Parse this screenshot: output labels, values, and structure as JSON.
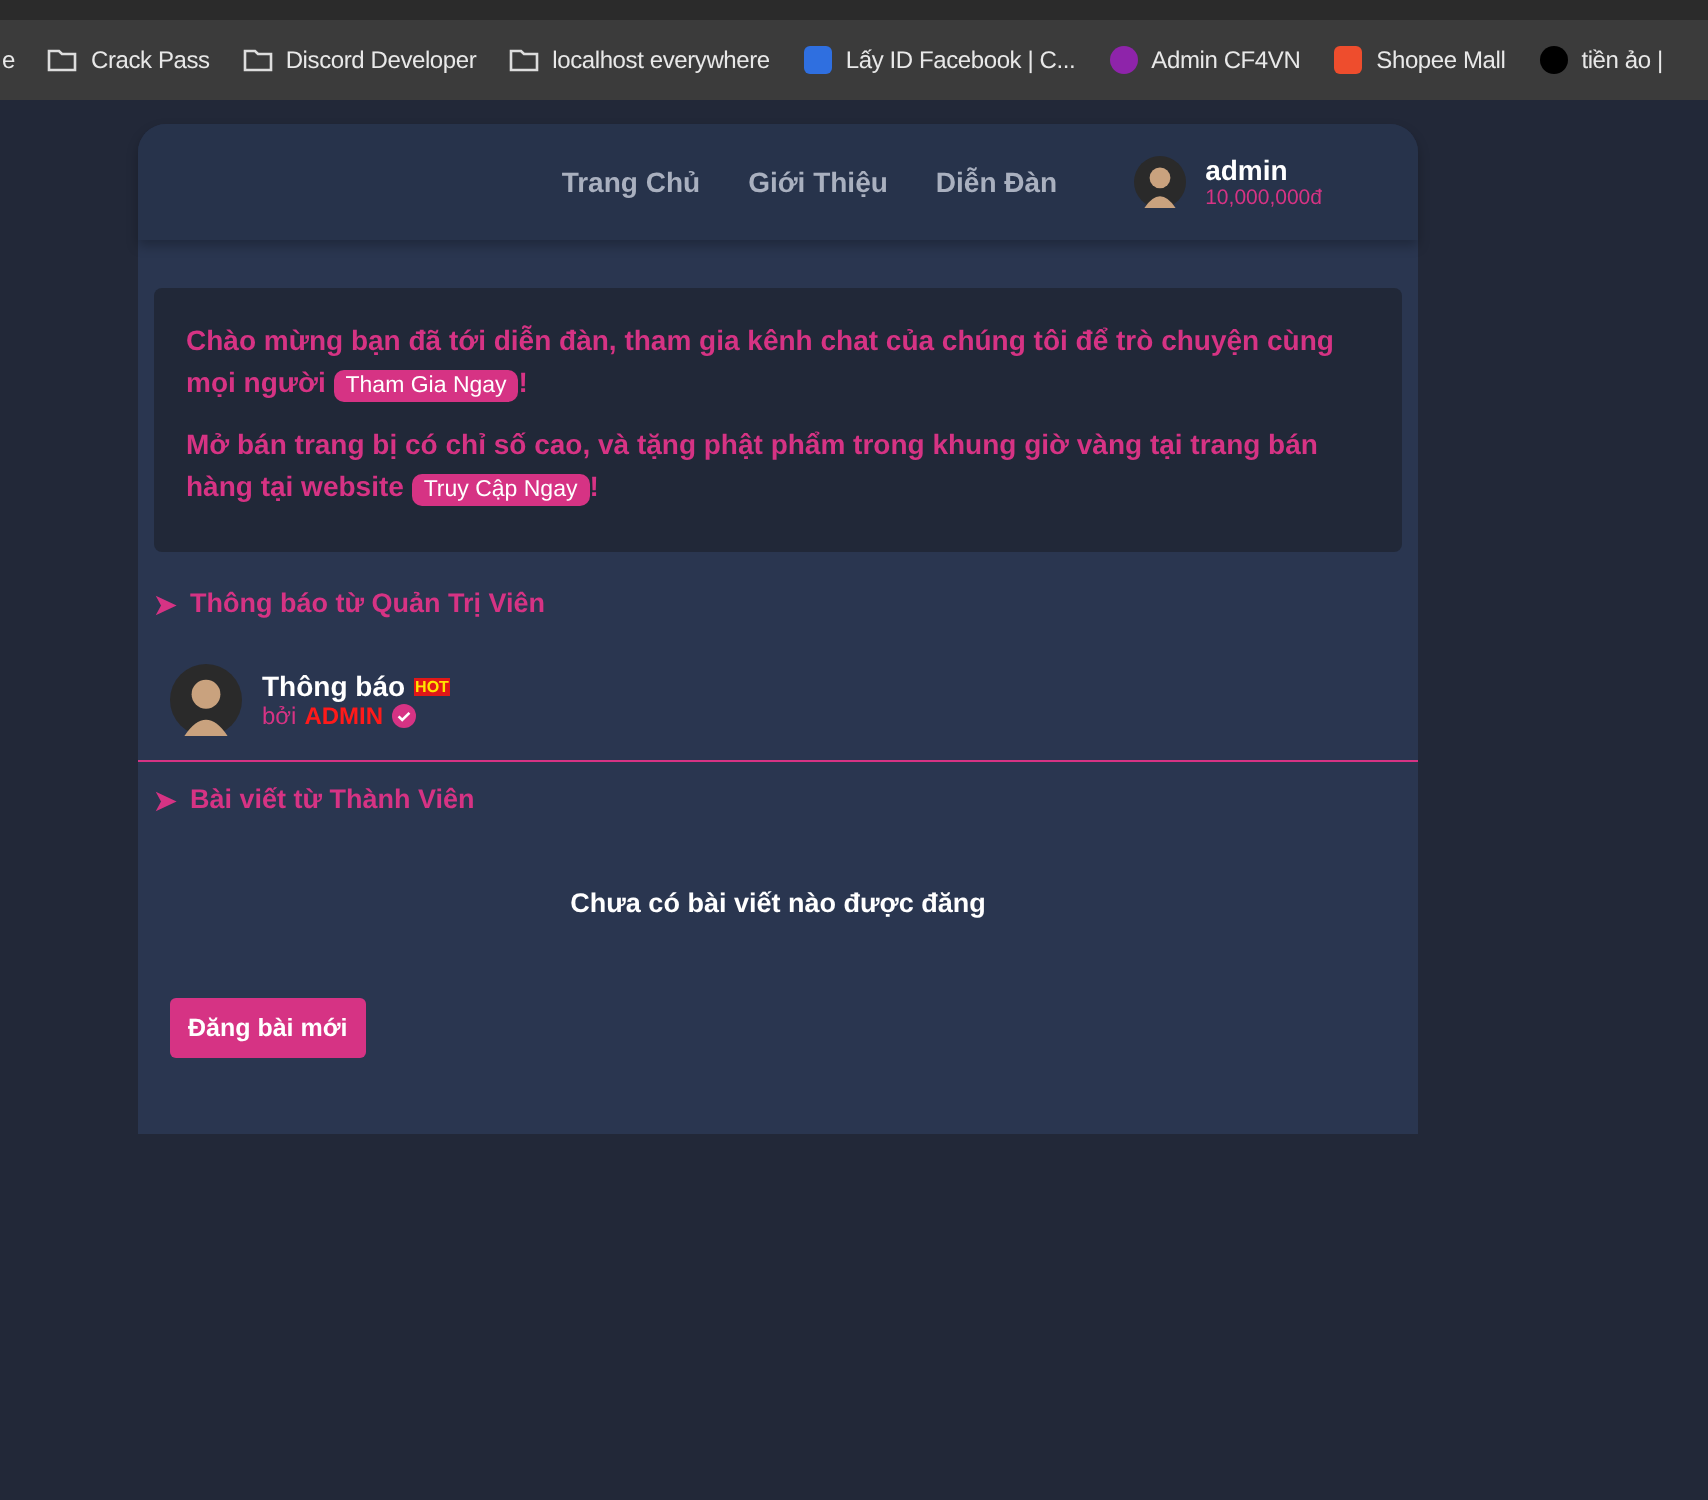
{
  "bookmarks": [
    {
      "label": "e",
      "kind": "none"
    },
    {
      "label": "Crack Pass",
      "kind": "folder"
    },
    {
      "label": "Discord Developer",
      "kind": "folder"
    },
    {
      "label": "localhost everywhere",
      "kind": "folder"
    },
    {
      "label": "Lấy ID Facebook | C...",
      "kind": "site",
      "color": "#2f6fe0"
    },
    {
      "label": "Admin CF4VN",
      "kind": "site",
      "color": "#8e24aa"
    },
    {
      "label": "Shopee Mall",
      "kind": "site",
      "color": "#ee4d2d"
    },
    {
      "label": "tiền ảo |",
      "kind": "site",
      "color": "#000000"
    }
  ],
  "nav": {
    "links": [
      "Trang Chủ",
      "Giới Thiệu",
      "Diễn Đàn"
    ],
    "user": {
      "name": "admin",
      "balance": "10,000,000đ"
    }
  },
  "notice": [
    {
      "before": "Chào mừng bạn đã tới diễn đàn, tham gia kênh chat của chúng tôi để trò chuyện cùng mọi người",
      "link": "Tham Gia Ngay",
      "after": "!"
    },
    {
      "before": "Mở bán trang bị có chỉ số cao, và tặng phật phẩm trong khung giờ vàng tại trang bán hàng tại website",
      "link": "Truy Cập Ngay",
      "after": "!"
    }
  ],
  "admin_section": {
    "arrow": "➤",
    "title": "Thông báo từ Quản Trị Viên",
    "posts": [
      {
        "title": "Thông báo",
        "badge": "HOT",
        "by": "bởi",
        "author": "ADMIN",
        "verified": true
      }
    ]
  },
  "member_section": {
    "arrow": "➤",
    "title": "Bài viết từ Thành Viên",
    "empty": "Chưa có bài viết nào được đăng"
  },
  "new_post_button": "Đăng bài mới"
}
